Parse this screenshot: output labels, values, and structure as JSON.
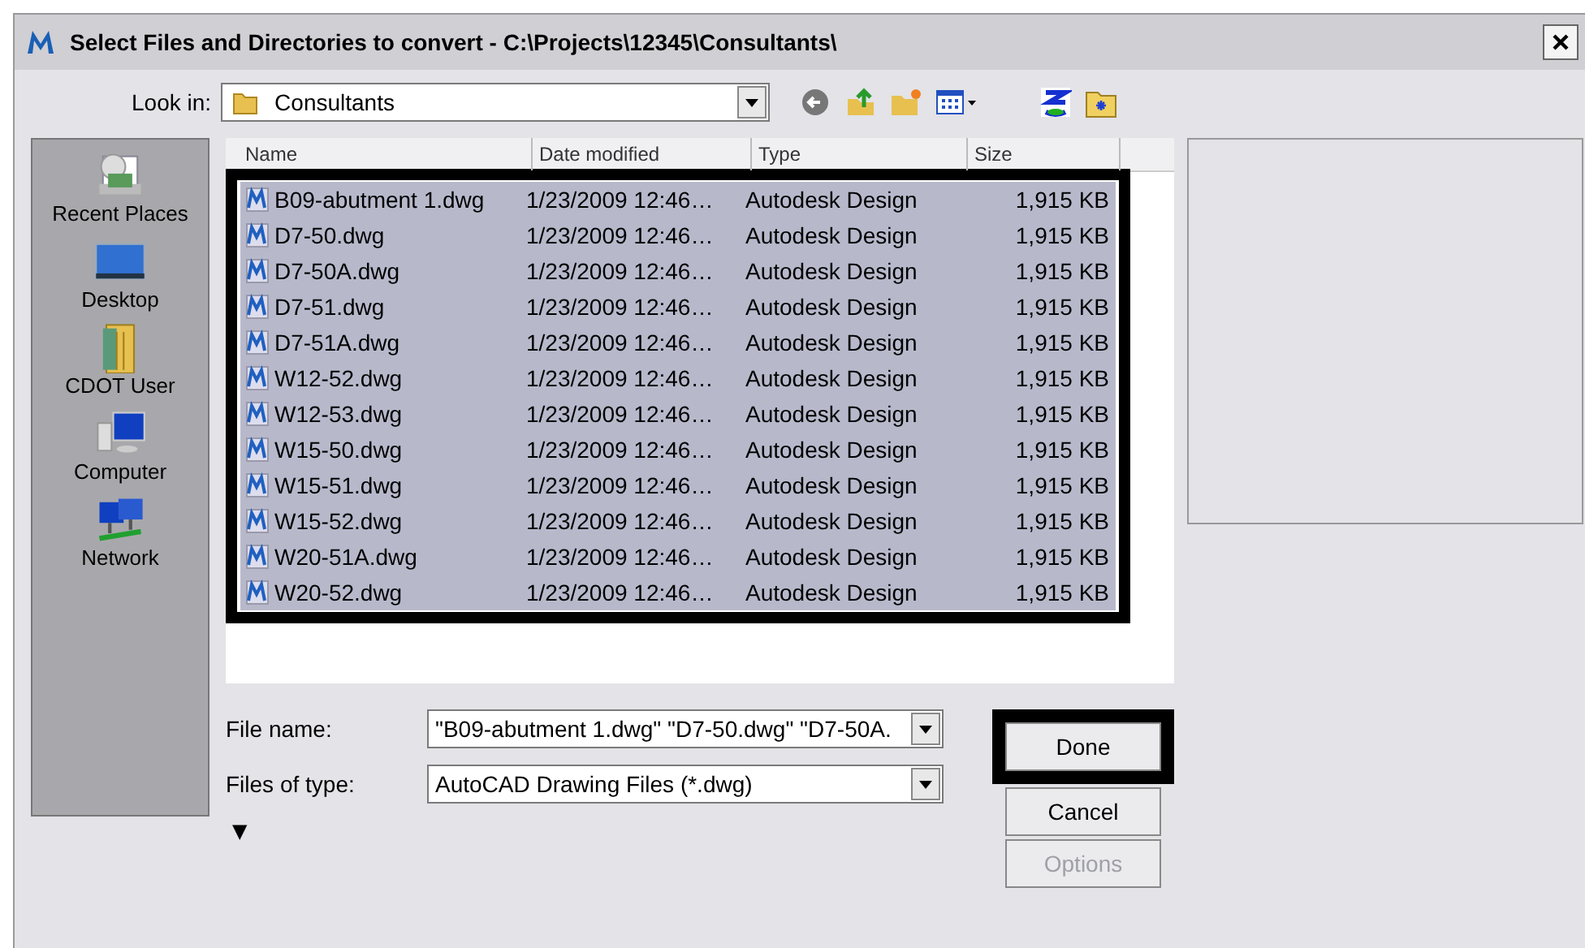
{
  "window": {
    "title": "Select Files and Directories to convert - C:\\Projects\\12345\\Consultants\\"
  },
  "look_in": {
    "label": "Look in:",
    "value": "Consultants"
  },
  "places": [
    {
      "label": "Recent Places",
      "kind": "recent"
    },
    {
      "label": "Desktop",
      "kind": "desktop"
    },
    {
      "label": "CDOT User",
      "kind": "user"
    },
    {
      "label": "Computer",
      "kind": "computer"
    },
    {
      "label": "Network",
      "kind": "network"
    }
  ],
  "table": {
    "columns": [
      "Name",
      "Date modified",
      "Type",
      "Size"
    ],
    "rows": [
      {
        "name": "B09-abutment 1.dwg",
        "date": "1/23/2009 12:46…",
        "type": "Autodesk Design",
        "size": "1,915 KB",
        "selected": true
      },
      {
        "name": "D7-50.dwg",
        "date": "1/23/2009 12:46…",
        "type": "Autodesk Design",
        "size": "1,915 KB",
        "selected": true
      },
      {
        "name": "D7-50A.dwg",
        "date": "1/23/2009 12:46…",
        "type": "Autodesk Design",
        "size": "1,915 KB",
        "selected": true
      },
      {
        "name": "D7-51.dwg",
        "date": "1/23/2009 12:46…",
        "type": "Autodesk Design",
        "size": "1,915 KB",
        "selected": true
      },
      {
        "name": "D7-51A.dwg",
        "date": "1/23/2009 12:46…",
        "type": "Autodesk Design",
        "size": "1,915 KB",
        "selected": true
      },
      {
        "name": "W12-52.dwg",
        "date": "1/23/2009 12:46…",
        "type": "Autodesk Design",
        "size": "1,915 KB",
        "selected": true
      },
      {
        "name": "W12-53.dwg",
        "date": "1/23/2009 12:46…",
        "type": "Autodesk Design",
        "size": "1,915 KB",
        "selected": true
      },
      {
        "name": "W15-50.dwg",
        "date": "1/23/2009 12:46…",
        "type": "Autodesk Design",
        "size": "1,915 KB",
        "selected": true
      },
      {
        "name": "W15-51.dwg",
        "date": "1/23/2009 12:46…",
        "type": "Autodesk Design",
        "size": "1,915 KB",
        "selected": true
      },
      {
        "name": "W15-52.dwg",
        "date": "1/23/2009 12:46…",
        "type": "Autodesk Design",
        "size": "1,915 KB",
        "selected": true
      },
      {
        "name": "W20-51A.dwg",
        "date": "1/23/2009 12:46…",
        "type": "Autodesk Design",
        "size": "1,915 KB",
        "selected": true
      },
      {
        "name": "W20-52.dwg",
        "date": "1/23/2009 12:46…",
        "type": "Autodesk Design",
        "size": "1,915 KB",
        "selected": true
      }
    ]
  },
  "file_name": {
    "label": "File name:",
    "value": "\"B09-abutment 1.dwg\" \"D7-50.dwg\" \"D7-50A."
  },
  "file_type": {
    "label": "Files of type:",
    "value": "AutoCAD Drawing Files (*.dwg)"
  },
  "expander": "▼",
  "buttons": [
    {
      "label": "Done",
      "disabled": false,
      "highlighted": true
    },
    {
      "label": "Cancel",
      "disabled": false,
      "highlighted": false
    },
    {
      "label": "Options",
      "disabled": true,
      "highlighted": false
    }
  ]
}
